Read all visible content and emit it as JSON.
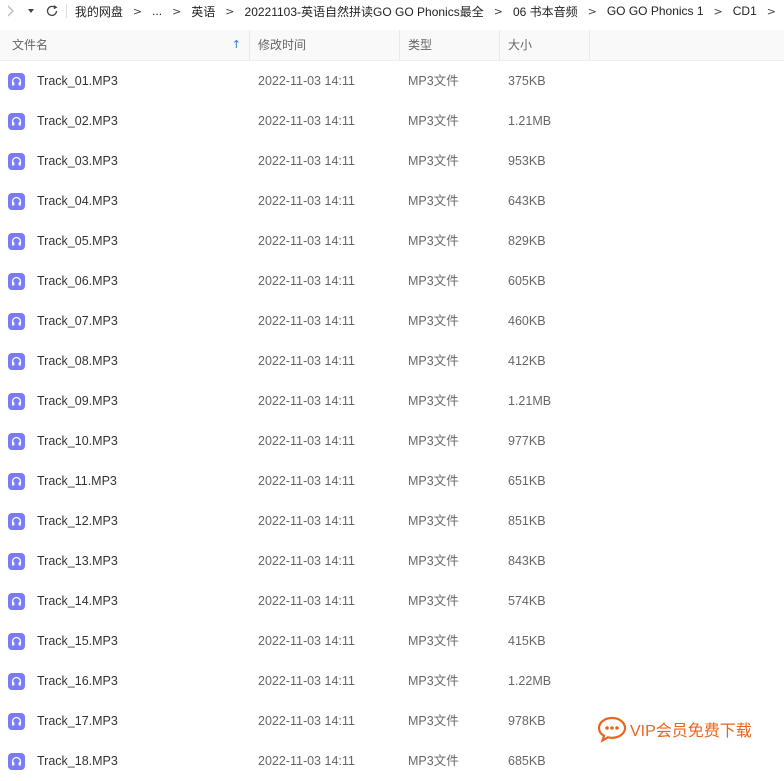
{
  "nav": {
    "breadcrumb": [
      "我的网盘",
      "...",
      "英语",
      "20221103-英语自然拼读GO GO Phonics最全",
      "06 书本音频",
      "GO GO Phonics 1",
      "CD1"
    ],
    "separator": ">"
  },
  "columns": {
    "name": "文件名",
    "date": "修改时间",
    "type": "类型",
    "size": "大小",
    "sort_indicator": "↑"
  },
  "files": [
    {
      "name": "Track_01.MP3",
      "date": "2022-11-03 14:11",
      "type": "MP3文件",
      "size": "375KB"
    },
    {
      "name": "Track_02.MP3",
      "date": "2022-11-03 14:11",
      "type": "MP3文件",
      "size": "1.21MB"
    },
    {
      "name": "Track_03.MP3",
      "date": "2022-11-03 14:11",
      "type": "MP3文件",
      "size": "953KB"
    },
    {
      "name": "Track_04.MP3",
      "date": "2022-11-03 14:11",
      "type": "MP3文件",
      "size": "643KB"
    },
    {
      "name": "Track_05.MP3",
      "date": "2022-11-03 14:11",
      "type": "MP3文件",
      "size": "829KB"
    },
    {
      "name": "Track_06.MP3",
      "date": "2022-11-03 14:11",
      "type": "MP3文件",
      "size": "605KB"
    },
    {
      "name": "Track_07.MP3",
      "date": "2022-11-03 14:11",
      "type": "MP3文件",
      "size": "460KB"
    },
    {
      "name": "Track_08.MP3",
      "date": "2022-11-03 14:11",
      "type": "MP3文件",
      "size": "412KB"
    },
    {
      "name": "Track_09.MP3",
      "date": "2022-11-03 14:11",
      "type": "MP3文件",
      "size": "1.21MB"
    },
    {
      "name": "Track_10.MP3",
      "date": "2022-11-03 14:11",
      "type": "MP3文件",
      "size": "977KB"
    },
    {
      "name": "Track_11.MP3",
      "date": "2022-11-03 14:11",
      "type": "MP3文件",
      "size": "651KB"
    },
    {
      "name": "Track_12.MP3",
      "date": "2022-11-03 14:11",
      "type": "MP3文件",
      "size": "851KB"
    },
    {
      "name": "Track_13.MP3",
      "date": "2022-11-03 14:11",
      "type": "MP3文件",
      "size": "843KB"
    },
    {
      "name": "Track_14.MP3",
      "date": "2022-11-03 14:11",
      "type": "MP3文件",
      "size": "574KB"
    },
    {
      "name": "Track_15.MP3",
      "date": "2022-11-03 14:11",
      "type": "MP3文件",
      "size": "415KB"
    },
    {
      "name": "Track_16.MP3",
      "date": "2022-11-03 14:11",
      "type": "MP3文件",
      "size": "1.22MB"
    },
    {
      "name": "Track_17.MP3",
      "date": "2022-11-03 14:11",
      "type": "MP3文件",
      "size": "978KB"
    },
    {
      "name": "Track_18.MP3",
      "date": "2022-11-03 14:11",
      "type": "MP3文件",
      "size": "685KB"
    }
  ],
  "icons": {
    "forward": "chevron-right-icon",
    "history": "chevron-down-icon",
    "refresh": "refresh-icon",
    "file": "audio-file-icon",
    "watermark": "chat-bubble-icon"
  },
  "colors": {
    "file_icon": "#7b7cf5",
    "sort_arrow": "#2a7bd8",
    "watermark": "#e8651e"
  },
  "watermark": {
    "text": "VIP会员免费下载"
  }
}
